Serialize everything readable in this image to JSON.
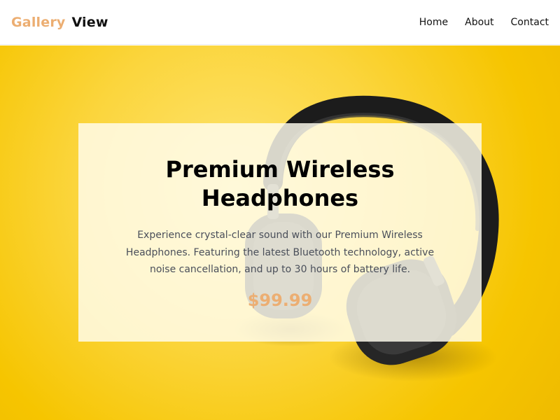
{
  "brand": {
    "first": "Gallery",
    "second": "View"
  },
  "nav": [
    {
      "label": "Home"
    },
    {
      "label": "About"
    },
    {
      "label": "Contact"
    }
  ],
  "hero": {
    "image_subject": "headphones",
    "background_color": "#f6c500"
  },
  "product": {
    "title": "Premium Wireless Headphones",
    "description": "Experience crystal-clear sound with our Premium Wireless Headphones. Featuring the latest Bluetooth technology, active noise cancellation, and up to 30 hours of battery life.",
    "price": "$99.99"
  },
  "colors": {
    "accent": "#ecae72",
    "text": "#111111",
    "hero_yellow": "#f6c500"
  }
}
